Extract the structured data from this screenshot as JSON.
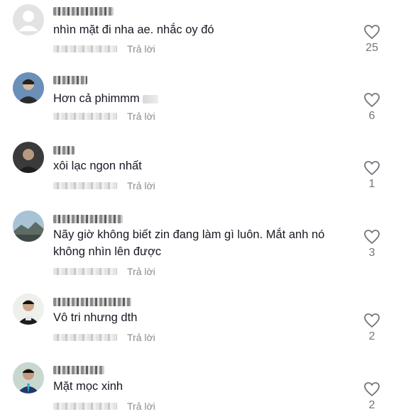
{
  "comments": [
    {
      "text": "nhìn mặt đi nha ae. nhắc oy đó",
      "reply": "Trả lời",
      "likes": "25",
      "avatar_icon": "default-avatar-icon"
    },
    {
      "text": "Hơn cả phimmm",
      "reply": "Trả lời",
      "likes": "6",
      "avatar_icon": "user-photo-icon"
    },
    {
      "text": "xôi lạc ngon nhất",
      "reply": "Trả lời",
      "likes": "1",
      "avatar_icon": "user-photo-icon"
    },
    {
      "text": "Nãy giờ không biết zin đang làm gì luôn. Mắt anh nó không nhìn lên được",
      "reply": "Trả lời",
      "likes": "3",
      "avatar_icon": "landscape-photo-icon"
    },
    {
      "text": "Vô tri nhưng dth",
      "reply": "Trả lời",
      "likes": "2",
      "avatar_icon": "user-photo-icon"
    },
    {
      "text": "Mặt mọc xinh",
      "reply": "Trả lời",
      "likes": "2",
      "avatar_icon": "user-photo-icon"
    }
  ],
  "colors": {
    "text": "#161823",
    "muted": "#8a8b91",
    "count": "#73747b"
  }
}
